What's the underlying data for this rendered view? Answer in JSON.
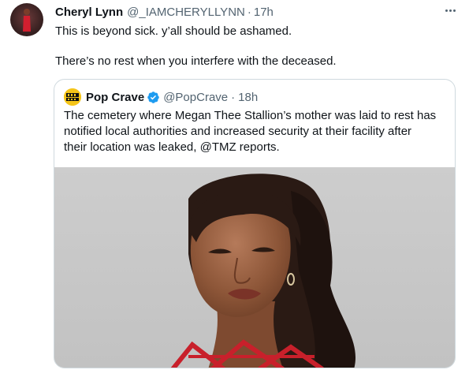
{
  "tweet": {
    "author_name": "Cheryl Lynn",
    "author_handle": "@_IAMCHERYLLYNN",
    "separator": "·",
    "time": "17h",
    "text_line1": "This is beyond sick. y’all should be ashamed.",
    "text_line2": "There’s no rest when you interfere with the deceased.",
    "more_icon": "more-horizontal-icon"
  },
  "quote": {
    "author_name": "Pop Crave",
    "author_handle": "@PopCrave",
    "separator": "·",
    "time": "18h",
    "avatar_text": "POP CRAVE",
    "verified_icon": "verified-badge-icon",
    "text_lines": [
      "The cemetery where Megan Thee Stallion’s mother was laid to rest has",
      "notified local authorities and increased security at their facility after",
      "their location was leaked, @TMZ reports."
    ]
  },
  "colors": {
    "text_primary": "#0f1419",
    "text_secondary": "#536471",
    "verified_blue": "#1d9bf0",
    "border": "#cfd9de",
    "pop_crave_yellow": "#f5c518"
  }
}
